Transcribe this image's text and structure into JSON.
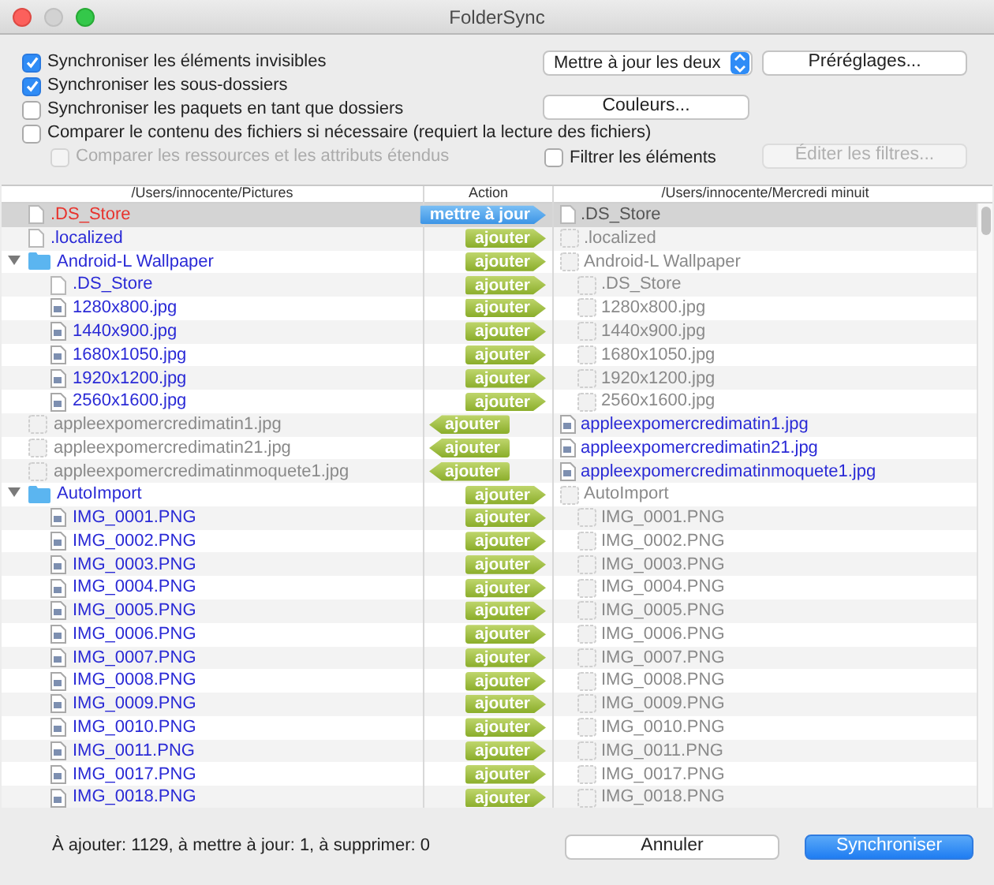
{
  "window": {
    "title": "FolderSync"
  },
  "options": [
    {
      "label": "Synchroniser les éléments invisibles",
      "checked": true,
      "disabled": false
    },
    {
      "label": "Synchroniser les sous-dossiers",
      "checked": true,
      "disabled": false
    },
    {
      "label": "Synchroniser les paquets en tant que dossiers",
      "checked": false,
      "disabled": false
    },
    {
      "label": "Comparer le contenu des fichiers si nécessaire (requiert la lecture des fichiers)",
      "checked": false,
      "disabled": false
    },
    {
      "label": "Comparer les ressources et les attributs étendus",
      "checked": false,
      "disabled": true
    }
  ],
  "mode_select": {
    "value": "Mettre à jour les deux"
  },
  "presets_button": {
    "label": "Préréglages...",
    "disabled": false
  },
  "colors_button": {
    "label": "Couleurs...",
    "disabled": false
  },
  "filter_checkbox": {
    "label": "Filtrer les éléments",
    "checked": false
  },
  "edit_filters_button": {
    "label": "Éditer les filtres...",
    "disabled": true
  },
  "table": {
    "columns": [
      "/Users/innocente/Pictures",
      "Action",
      "/Users/innocente/Mercredi minuit"
    ],
    "rows": [
      {
        "selected": true,
        "left": {
          "name": ".DS_Store",
          "kind": "file",
          "color": "#e8322c"
        },
        "action": {
          "label": "mettre à jour",
          "kind": "update"
        },
        "right": {
          "name": ".DS_Store",
          "kind": "file",
          "color": "#555555"
        }
      },
      {
        "selected": false,
        "left": {
          "name": ".localized",
          "kind": "file",
          "color": "#2a2ad6"
        },
        "action": {
          "label": "ajouter",
          "kind": "add-right"
        },
        "right": {
          "name": ".localized",
          "kind": "placeholder",
          "color": "#8a8a8a"
        }
      },
      {
        "selected": false,
        "expanded": true,
        "left": {
          "name": "Android-L Wallpaper",
          "kind": "folder",
          "color": "#2a2ad6"
        },
        "action": {
          "label": "ajouter",
          "kind": "add-right"
        },
        "right": {
          "name": "Android-L Wallpaper",
          "kind": "placeholder",
          "color": "#8a8a8a"
        },
        "children": [
          {
            "selected": false,
            "left": {
              "name": ".DS_Store",
              "kind": "file",
              "color": "#2a2ad6"
            },
            "action": {
              "label": "ajouter",
              "kind": "add-right"
            },
            "right": {
              "name": ".DS_Store",
              "kind": "placeholder",
              "color": "#8a8a8a"
            }
          },
          {
            "selected": false,
            "left": {
              "name": "1280x800.jpg",
              "kind": "image",
              "color": "#2a2ad6"
            },
            "action": {
              "label": "ajouter",
              "kind": "add-right"
            },
            "right": {
              "name": "1280x800.jpg",
              "kind": "placeholder",
              "color": "#8a8a8a"
            }
          },
          {
            "selected": false,
            "left": {
              "name": "1440x900.jpg",
              "kind": "image",
              "color": "#2a2ad6"
            },
            "action": {
              "label": "ajouter",
              "kind": "add-right"
            },
            "right": {
              "name": "1440x900.jpg",
              "kind": "placeholder",
              "color": "#8a8a8a"
            }
          },
          {
            "selected": false,
            "left": {
              "name": "1680x1050.jpg",
              "kind": "image",
              "color": "#2a2ad6"
            },
            "action": {
              "label": "ajouter",
              "kind": "add-right"
            },
            "right": {
              "name": "1680x1050.jpg",
              "kind": "placeholder",
              "color": "#8a8a8a"
            }
          },
          {
            "selected": false,
            "left": {
              "name": "1920x1200.jpg",
              "kind": "image",
              "color": "#2a2ad6"
            },
            "action": {
              "label": "ajouter",
              "kind": "add-right"
            },
            "right": {
              "name": "1920x1200.jpg",
              "kind": "placeholder",
              "color": "#8a8a8a"
            }
          },
          {
            "selected": false,
            "left": {
              "name": "2560x1600.jpg",
              "kind": "image",
              "color": "#2a2ad6"
            },
            "action": {
              "label": "ajouter",
              "kind": "add-right"
            },
            "right": {
              "name": "2560x1600.jpg",
              "kind": "placeholder",
              "color": "#8a8a8a"
            }
          }
        ]
      },
      {
        "selected": false,
        "left": {
          "name": "appleexpomercredimatin1.jpg",
          "kind": "placeholder",
          "color": "#8a8a8a"
        },
        "action": {
          "label": "ajouter",
          "kind": "add-left"
        },
        "right": {
          "name": "appleexpomercredimatin1.jpg",
          "kind": "image",
          "color": "#2a2ad6"
        }
      },
      {
        "selected": false,
        "left": {
          "name": "appleexpomercredimatin21.jpg",
          "kind": "placeholder",
          "color": "#8a8a8a"
        },
        "action": {
          "label": "ajouter",
          "kind": "add-left"
        },
        "right": {
          "name": "appleexpomercredimatin21.jpg",
          "kind": "image",
          "color": "#2a2ad6"
        }
      },
      {
        "selected": false,
        "left": {
          "name": "appleexpomercredimatinmoquete1.jpg",
          "kind": "placeholder",
          "color": "#8a8a8a"
        },
        "action": {
          "label": "ajouter",
          "kind": "add-left"
        },
        "right": {
          "name": "appleexpomercredimatinmoquete1.jpg",
          "kind": "image",
          "color": "#2a2ad6"
        }
      },
      {
        "selected": false,
        "expanded": true,
        "left": {
          "name": "AutoImport",
          "kind": "folder",
          "color": "#2a2ad6"
        },
        "action": {
          "label": "ajouter",
          "kind": "add-right"
        },
        "right": {
          "name": "AutoImport",
          "kind": "placeholder",
          "color": "#8a8a8a"
        },
        "children": [
          {
            "selected": false,
            "left": {
              "name": "IMG_0001.PNG",
              "kind": "image",
              "color": "#2a2ad6"
            },
            "action": {
              "label": "ajouter",
              "kind": "add-right"
            },
            "right": {
              "name": "IMG_0001.PNG",
              "kind": "placeholder",
              "color": "#8a8a8a"
            }
          },
          {
            "selected": false,
            "left": {
              "name": "IMG_0002.PNG",
              "kind": "image",
              "color": "#2a2ad6"
            },
            "action": {
              "label": "ajouter",
              "kind": "add-right"
            },
            "right": {
              "name": "IMG_0002.PNG",
              "kind": "placeholder",
              "color": "#8a8a8a"
            }
          },
          {
            "selected": false,
            "left": {
              "name": "IMG_0003.PNG",
              "kind": "image",
              "color": "#2a2ad6"
            },
            "action": {
              "label": "ajouter",
              "kind": "add-right"
            },
            "right": {
              "name": "IMG_0003.PNG",
              "kind": "placeholder",
              "color": "#8a8a8a"
            }
          },
          {
            "selected": false,
            "left": {
              "name": "IMG_0004.PNG",
              "kind": "image",
              "color": "#2a2ad6"
            },
            "action": {
              "label": "ajouter",
              "kind": "add-right"
            },
            "right": {
              "name": "IMG_0004.PNG",
              "kind": "placeholder",
              "color": "#8a8a8a"
            }
          },
          {
            "selected": false,
            "left": {
              "name": "IMG_0005.PNG",
              "kind": "image",
              "color": "#2a2ad6"
            },
            "action": {
              "label": "ajouter",
              "kind": "add-right"
            },
            "right": {
              "name": "IMG_0005.PNG",
              "kind": "placeholder",
              "color": "#8a8a8a"
            }
          },
          {
            "selected": false,
            "left": {
              "name": "IMG_0006.PNG",
              "kind": "image",
              "color": "#2a2ad6"
            },
            "action": {
              "label": "ajouter",
              "kind": "add-right"
            },
            "right": {
              "name": "IMG_0006.PNG",
              "kind": "placeholder",
              "color": "#8a8a8a"
            }
          },
          {
            "selected": false,
            "left": {
              "name": "IMG_0007.PNG",
              "kind": "image",
              "color": "#2a2ad6"
            },
            "action": {
              "label": "ajouter",
              "kind": "add-right"
            },
            "right": {
              "name": "IMG_0007.PNG",
              "kind": "placeholder",
              "color": "#8a8a8a"
            }
          },
          {
            "selected": false,
            "left": {
              "name": "IMG_0008.PNG",
              "kind": "image",
              "color": "#2a2ad6"
            },
            "action": {
              "label": "ajouter",
              "kind": "add-right"
            },
            "right": {
              "name": "IMG_0008.PNG",
              "kind": "placeholder",
              "color": "#8a8a8a"
            }
          },
          {
            "selected": false,
            "left": {
              "name": "IMG_0009.PNG",
              "kind": "image",
              "color": "#2a2ad6"
            },
            "action": {
              "label": "ajouter",
              "kind": "add-right"
            },
            "right": {
              "name": "IMG_0009.PNG",
              "kind": "placeholder",
              "color": "#8a8a8a"
            }
          },
          {
            "selected": false,
            "left": {
              "name": "IMG_0010.PNG",
              "kind": "image",
              "color": "#2a2ad6"
            },
            "action": {
              "label": "ajouter",
              "kind": "add-right"
            },
            "right": {
              "name": "IMG_0010.PNG",
              "kind": "placeholder",
              "color": "#8a8a8a"
            }
          },
          {
            "selected": false,
            "left": {
              "name": "IMG_0011.PNG",
              "kind": "image",
              "color": "#2a2ad6"
            },
            "action": {
              "label": "ajouter",
              "kind": "add-right"
            },
            "right": {
              "name": "IMG_0011.PNG",
              "kind": "placeholder",
              "color": "#8a8a8a"
            }
          },
          {
            "selected": false,
            "left": {
              "name": "IMG_0017.PNG",
              "kind": "image",
              "color": "#2a2ad6"
            },
            "action": {
              "label": "ajouter",
              "kind": "add-right"
            },
            "right": {
              "name": "IMG_0017.PNG",
              "kind": "placeholder",
              "color": "#8a8a8a"
            }
          },
          {
            "selected": false,
            "left": {
              "name": "IMG_0018.PNG",
              "kind": "image",
              "color": "#2a2ad6"
            },
            "action": {
              "label": "ajouter",
              "kind": "add-right"
            },
            "right": {
              "name": "IMG_0018.PNG",
              "kind": "placeholder",
              "color": "#8a8a8a"
            }
          }
        ]
      }
    ]
  },
  "status": "À ajouter: 1129, à mettre à jour: 1, à supprimer: 0",
  "buttons": [
    {
      "label": "Annuler",
      "kind": "secondary"
    },
    {
      "label": "Synchroniser",
      "kind": "primary"
    }
  ]
}
